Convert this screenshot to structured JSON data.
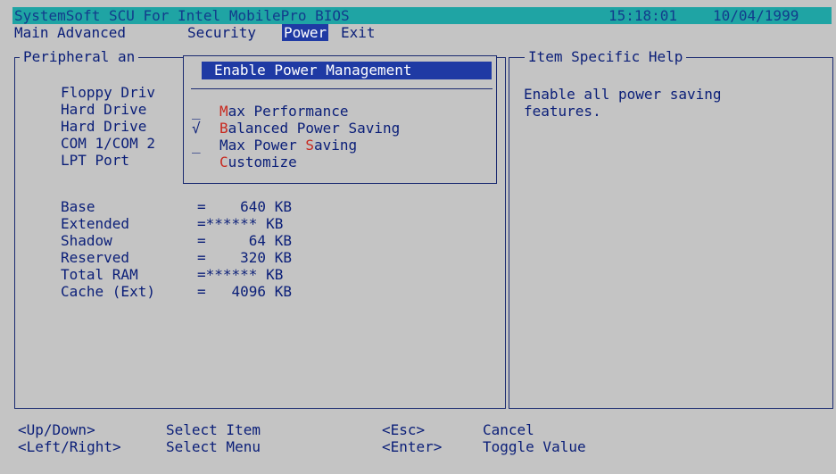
{
  "title_bar": {
    "product": "SystemSoft SCU For Intel MobilePro BIOS",
    "time": "15:18:01",
    "date": "10/04/1999"
  },
  "menu": [
    {
      "label": "Main"
    },
    {
      "label": "Advanced"
    },
    {
      "label": "Security"
    },
    {
      "label": "Power",
      "selected": true
    },
    {
      "label": "Exit"
    }
  ],
  "left_panel": {
    "title": "Peripheral an",
    "peripherals": [
      "Floppy Driv",
      "Hard Drive",
      "Hard Drive",
      "COM 1/COM 2",
      "LPT Port"
    ],
    "memory": [
      {
        "label": "Base",
        "value": "=    640 KB"
      },
      {
        "label": "Extended",
        "value": "=****** KB"
      },
      {
        "label": "Shadow",
        "value": "=     64 KB"
      },
      {
        "label": "Reserved",
        "value": "=    320 KB"
      },
      {
        "label": "Total RAM",
        "value": "=****** KB"
      },
      {
        "label": "Cache (Ext)",
        "value": "=   4096 KB"
      }
    ]
  },
  "popup": {
    "check_mark": "√",
    "enable_label": "Enable Power Management",
    "options": [
      {
        "label": "Max Performance",
        "marker": "_",
        "hot_index": 0
      },
      {
        "label": "Balanced Power Saving",
        "marker": "√",
        "hot_index": 0
      },
      {
        "label": "Max Power Saving",
        "marker": "_",
        "hot_index": 10
      },
      {
        "label": "Customize",
        "marker": "",
        "hot_index": 0
      }
    ]
  },
  "help_panel": {
    "title": "Item Specific Help",
    "text": "Enable all power saving\nfeatures."
  },
  "footer": [
    {
      "key": "<Up/Down>",
      "action": "Select Item"
    },
    {
      "key": "<Left/Right>",
      "action": "Select Menu"
    },
    {
      "key": "<Esc>",
      "action": "Cancel"
    },
    {
      "key": "<Enter>",
      "action": "Toggle Value"
    }
  ],
  "colors": {
    "background": "#c4c4c4",
    "text": "#0a1e78",
    "title_bar": "#1fa4a4",
    "highlight": "#1f3aa4",
    "hotkey": "#c8281e"
  }
}
